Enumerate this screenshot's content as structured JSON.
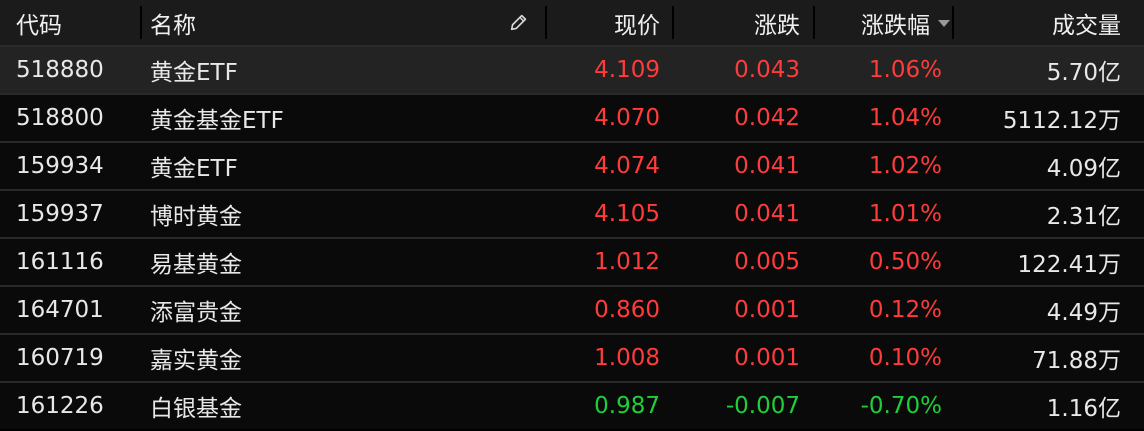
{
  "header": {
    "code": "代码",
    "name": "名称",
    "price": "现价",
    "change": "涨跌",
    "pct": "涨跌幅",
    "volume": "成交量"
  },
  "rows": [
    {
      "code": "518880",
      "name": "黄金ETF",
      "price": "4.109",
      "change": "0.043",
      "pct": "1.06%",
      "volume": "5.70亿",
      "dir": "up"
    },
    {
      "code": "518800",
      "name": "黄金基金ETF",
      "price": "4.070",
      "change": "0.042",
      "pct": "1.04%",
      "volume": "5112.12万",
      "dir": "up"
    },
    {
      "code": "159934",
      "name": "黄金ETF",
      "price": "4.074",
      "change": "0.041",
      "pct": "1.02%",
      "volume": "4.09亿",
      "dir": "up"
    },
    {
      "code": "159937",
      "name": "博时黄金",
      "price": "4.105",
      "change": "0.041",
      "pct": "1.01%",
      "volume": "2.31亿",
      "dir": "up"
    },
    {
      "code": "161116",
      "name": "易基黄金",
      "price": "1.012",
      "change": "0.005",
      "pct": "0.50%",
      "volume": "122.41万",
      "dir": "up"
    },
    {
      "code": "164701",
      "name": "添富贵金",
      "price": "0.860",
      "change": "0.001",
      "pct": "0.12%",
      "volume": "4.49万",
      "dir": "up"
    },
    {
      "code": "160719",
      "name": "嘉实黄金",
      "price": "1.008",
      "change": "0.001",
      "pct": "0.10%",
      "volume": "71.88万",
      "dir": "up"
    },
    {
      "code": "161226",
      "name": "白银基金",
      "price": "0.987",
      "change": "-0.007",
      "pct": "-0.70%",
      "volume": "1.16亿",
      "dir": "down"
    }
  ],
  "colors": {
    "up": "#ff3b3b",
    "down": "#1ecf3a"
  },
  "icons": {
    "edit": "pencil-icon",
    "sort": "sort-desc-icon"
  }
}
